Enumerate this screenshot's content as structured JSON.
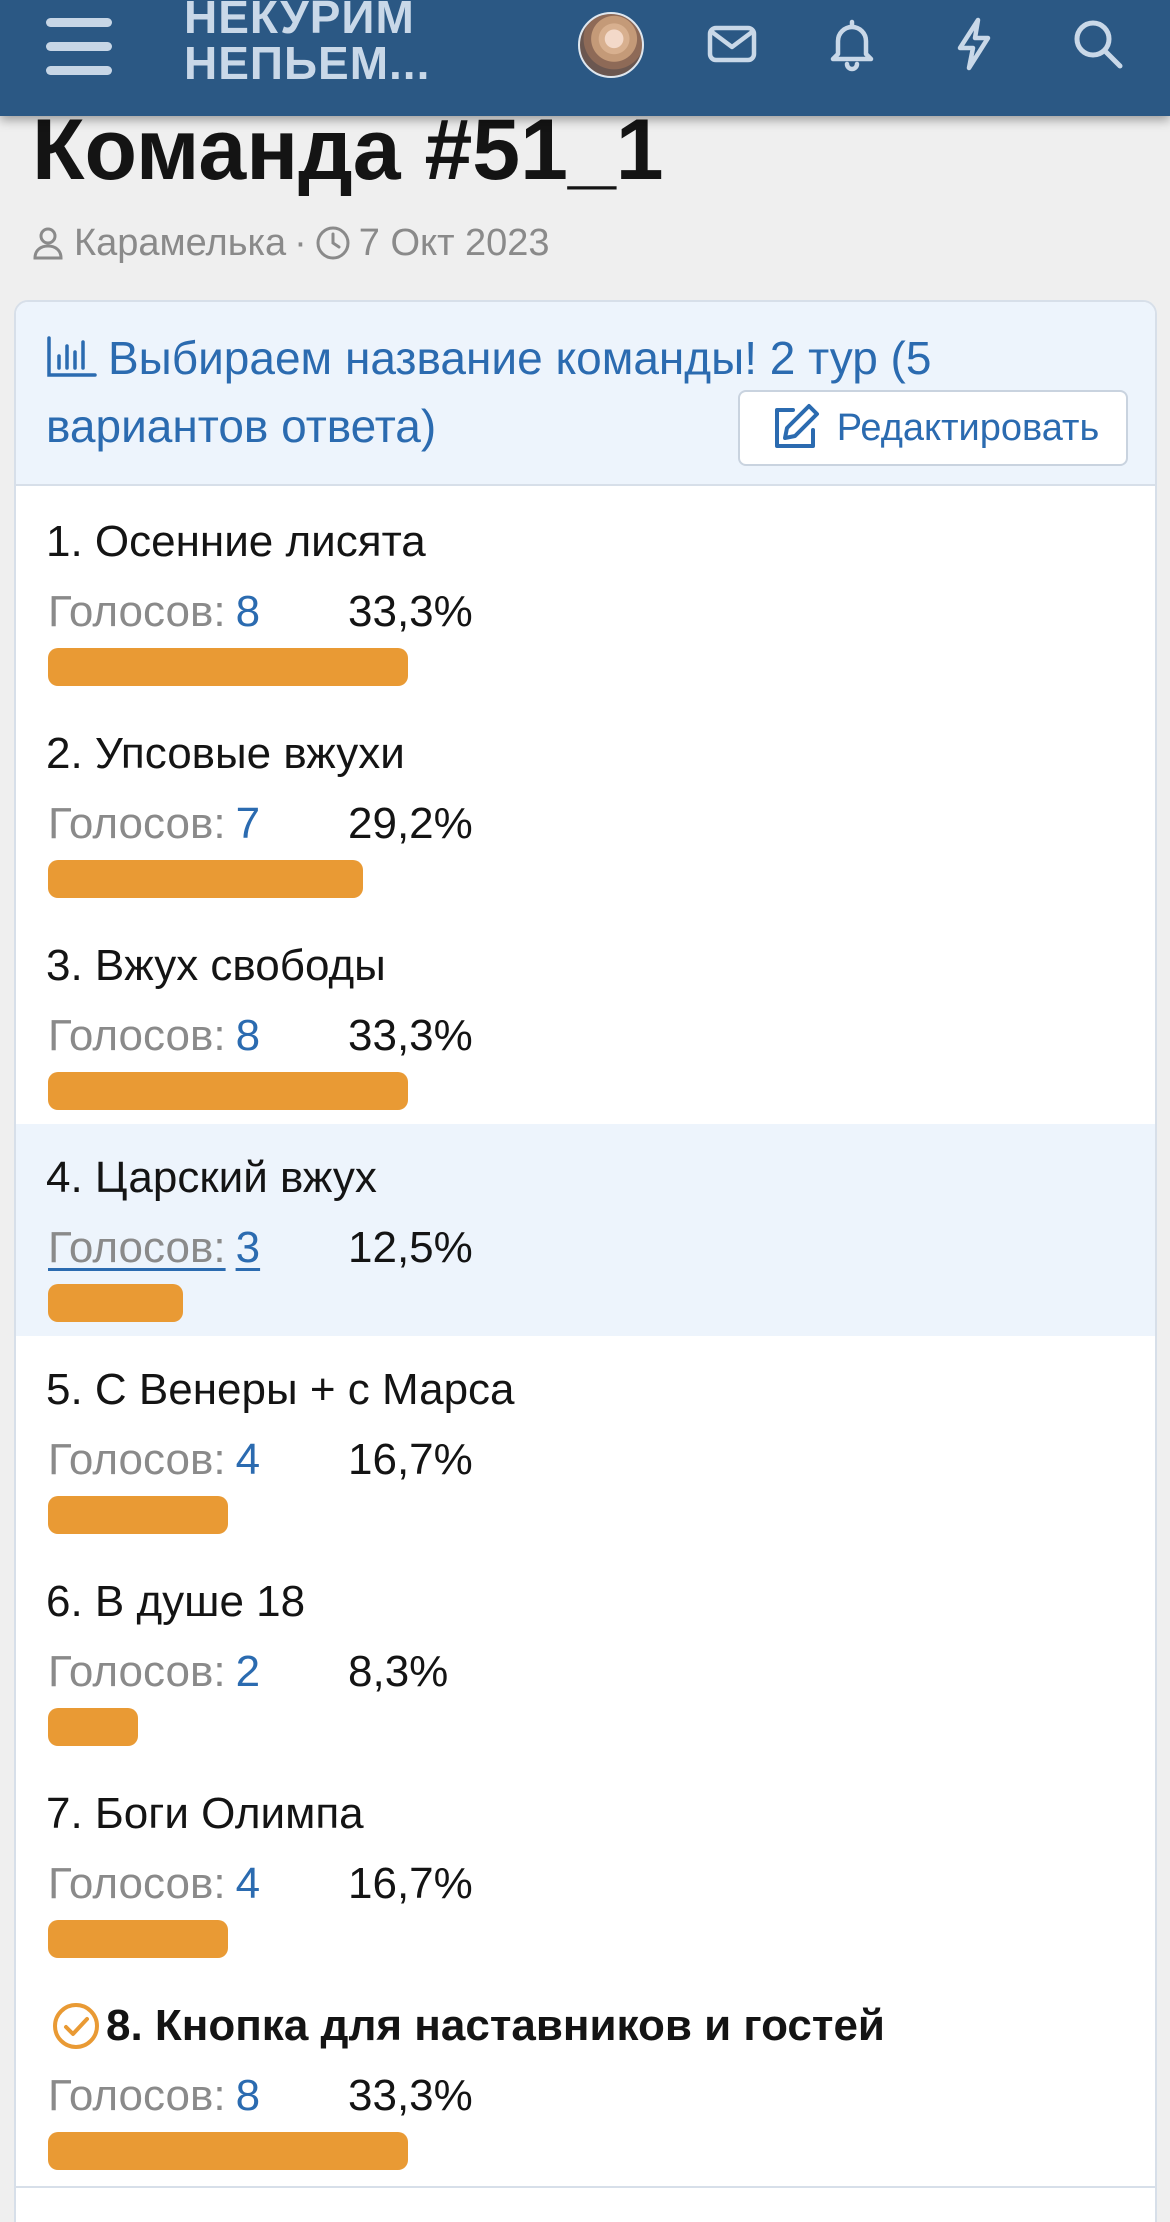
{
  "header": {
    "logo_line1": "НЕКУРИМ",
    "logo_line2": "НЕПЬЕМ...",
    "icons": [
      "menu-icon",
      "avatar",
      "mail-icon",
      "bell-icon",
      "bolt-icon",
      "search-icon"
    ],
    "background": "#2b5884"
  },
  "thread": {
    "title": "Команда #51_1",
    "author": "Карамелька",
    "separator": "·",
    "date": "7 Окт 2023"
  },
  "poll": {
    "question": "Выбираем название команды! 2 тур (5 вариантов ответа)",
    "edit_label": "Редактировать",
    "votes_label": "Голосов:",
    "bar_color": "#e99a34",
    "accent_color": "#2b6bb0",
    "options": [
      {
        "label": "1. Осенние лисята",
        "votes": "8",
        "percent": "33,3%",
        "fraction": 0.333
      },
      {
        "label": "2. Упсовые вжухи",
        "votes": "7",
        "percent": "29,2%",
        "fraction": 0.292
      },
      {
        "label": "3. Вжух свободы",
        "votes": "8",
        "percent": "33,3%",
        "fraction": 0.333
      },
      {
        "label": "4. Царский вжух",
        "votes": "3",
        "percent": "12,5%",
        "fraction": 0.125
      },
      {
        "label": "5. С Венеры + с Марса",
        "votes": "4",
        "percent": "16,7%",
        "fraction": 0.167
      },
      {
        "label": "6. В душе 18",
        "votes": "2",
        "percent": "8,3%",
        "fraction": 0.083
      },
      {
        "label": "7. Боги Олимпа",
        "votes": "4",
        "percent": "16,7%",
        "fraction": 0.167
      },
      {
        "label": "8. Кнопка для наставников и гостей",
        "votes": "8",
        "percent": "33,3%",
        "fraction": 0.333,
        "selected": true
      }
    ]
  }
}
